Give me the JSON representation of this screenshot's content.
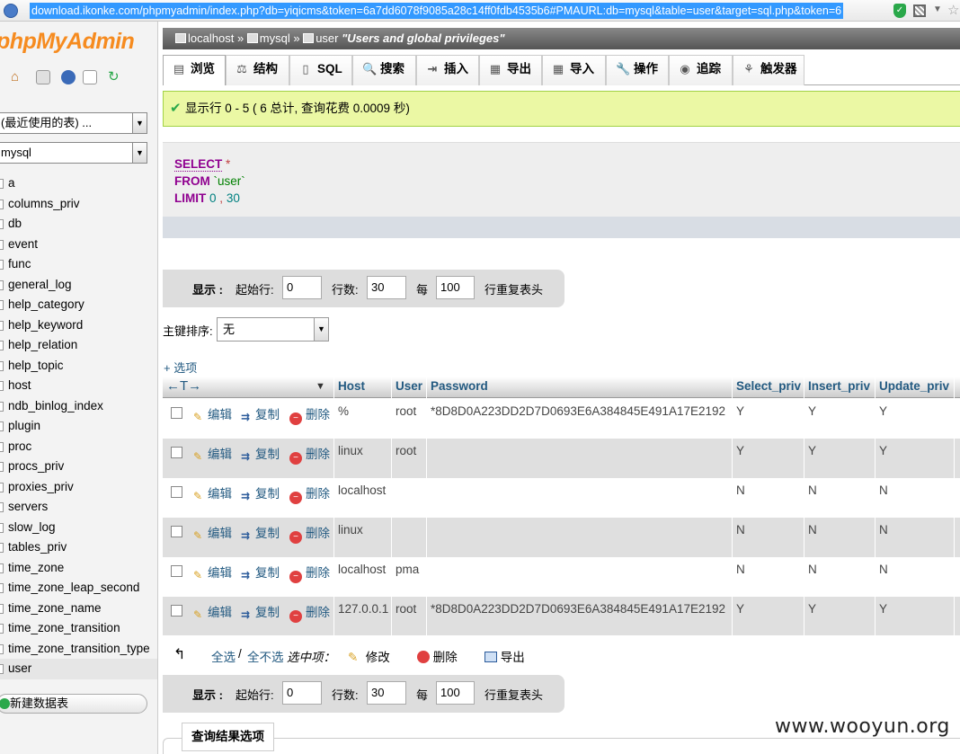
{
  "browser": {
    "url": "download.ikonke.com/phpmyadmin/index.php?db=yiqicms&token=6a7dd6078f9085a28c14ff0fdb4535b6#PMAURL:db=mysql&table=user&target=sql.php&token=6"
  },
  "sidebar": {
    "logo_php": "php",
    "logo_myadmin": "MyAdmin",
    "recent_select": "(最近使用的表) ...",
    "db_select": "mysql",
    "tables": [
      "a",
      "columns_priv",
      "db",
      "event",
      "func",
      "general_log",
      "help_category",
      "help_keyword",
      "help_relation",
      "help_topic",
      "host",
      "ndb_binlog_index",
      "plugin",
      "proc",
      "procs_priv",
      "proxies_priv",
      "servers",
      "slow_log",
      "tables_priv",
      "time_zone",
      "time_zone_leap_second",
      "time_zone_name",
      "time_zone_transition",
      "time_zone_transition_type",
      "user"
    ],
    "new_table": "新建数据表"
  },
  "breadcrumb": {
    "server": "localhost",
    "db": "mysql",
    "table": "user",
    "comment": "\"Users and global privileges\""
  },
  "tabs": [
    {
      "label": "浏览",
      "icon": "▤"
    },
    {
      "label": "结构",
      "icon": "⚖"
    },
    {
      "label": "SQL",
      "icon": "▯"
    },
    {
      "label": "搜索",
      "icon": "🔍"
    },
    {
      "label": "插入",
      "icon": "⇥"
    },
    {
      "label": "导出",
      "icon": "▦"
    },
    {
      "label": "导入",
      "icon": "▦"
    },
    {
      "label": "操作",
      "icon": "🔧"
    },
    {
      "label": "追踪",
      "icon": "◉"
    },
    {
      "label": "触发器",
      "icon": "⚘"
    }
  ],
  "notice": "显示行 0 - 5 ( 6 总计, 查询花费 0.0009 秒)",
  "sql": {
    "select": "SELECT",
    "star": "*",
    "from": "FROM",
    "table": "`user`",
    "limit": "LIMIT",
    "offset": "0",
    "comma": ",",
    "count": "30"
  },
  "nav": {
    "show_label": "显示 :",
    "start_label": "起始行:",
    "start_value": "0",
    "rows_label": "行数:",
    "rows_value": "30",
    "every_label": "每",
    "every_value": "100",
    "repeat_label": "行重复表头"
  },
  "sort": {
    "label": "主键排序:",
    "value": "无"
  },
  "options_link": "+ 选项",
  "table": {
    "arrows": "←T→",
    "sorter": "▼",
    "columns": [
      "Host",
      "User",
      "Password",
      "Select_priv",
      "Insert_priv",
      "Update_priv"
    ],
    "action_edit": "编辑",
    "action_copy": "复制",
    "action_delete": "删除",
    "rows": [
      [
        "%",
        "root",
        "*8D8D0A223DD2D7D0693E6A384845E491A17E2192",
        "Y",
        "Y",
        "Y"
      ],
      [
        "linux",
        "root",
        "",
        "Y",
        "Y",
        "Y"
      ],
      [
        "localhost",
        "",
        "",
        "N",
        "N",
        "N"
      ],
      [
        "linux",
        "",
        "",
        "N",
        "N",
        "N"
      ],
      [
        "localhost",
        "pma",
        "",
        "N",
        "N",
        "N"
      ],
      [
        "127.0.0.1",
        "root",
        "*8D8D0A223DD2D7D0693E6A384845E491A17E2192",
        "Y",
        "Y",
        "Y"
      ]
    ]
  },
  "bottom": {
    "select_all": "全选",
    "sep": "/",
    "unselect_all": "全不选",
    "selected": "选中项：",
    "modify": "修改",
    "delete": "删除",
    "export": "导出"
  },
  "result_options": "查询结果选项",
  "watermark": "www.wooyun.org"
}
